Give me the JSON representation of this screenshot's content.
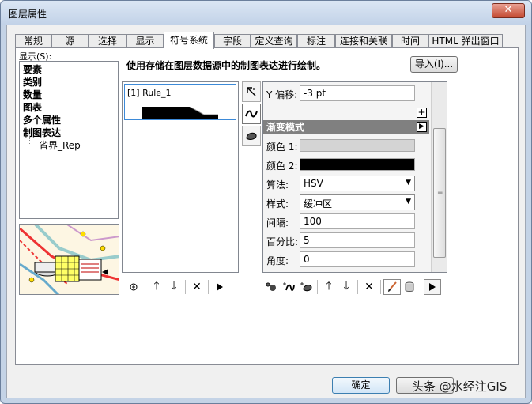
{
  "window": {
    "title": "图层属性",
    "close_label": "✕"
  },
  "tabs": [
    {
      "label": "常规",
      "active": false
    },
    {
      "label": "源",
      "active": false
    },
    {
      "label": "选择",
      "active": false
    },
    {
      "label": "显示",
      "active": false
    },
    {
      "label": "符号系统",
      "active": true
    },
    {
      "label": "字段",
      "active": false
    },
    {
      "label": "定义查询",
      "active": false
    },
    {
      "label": "标注",
      "active": false
    },
    {
      "label": "连接和关联",
      "active": false
    },
    {
      "label": "时间",
      "active": false
    },
    {
      "label": "HTML 弹出窗口",
      "active": false
    }
  ],
  "show_panel": {
    "label": "显示(S):",
    "items": [
      "要素",
      "类别",
      "数量",
      "图表",
      "多个属性",
      "制图表达"
    ],
    "child_item": "省界_Rep"
  },
  "description": "使用存储在图层数据源中的制图表达进行绘制。",
  "import_button": "导入(I)...",
  "rules": [
    {
      "label": "[1] Rule_1"
    }
  ],
  "properties": {
    "y_offset": {
      "label": "Y 偏移:",
      "value": "-3 pt"
    },
    "expand_symbol": "+",
    "gradient_section": "渐变模式",
    "color1": {
      "label": "颜色 1:",
      "color": "#d4d4d4"
    },
    "color2": {
      "label": "颜色 2:",
      "color": "#000000"
    },
    "algorithm": {
      "label": "算法:",
      "value": "HSV"
    },
    "style": {
      "label": "样式:",
      "value": "缓冲区"
    },
    "interval": {
      "label": "间隔:",
      "value": "100"
    },
    "percent": {
      "label": "百分比:",
      "value": "5"
    },
    "angle": {
      "label": "角度:",
      "value": "0"
    }
  },
  "buttons": {
    "ok": "确定"
  },
  "watermark": "头条 @水经注GIS",
  "colors": {
    "accent": "#3d8ad8",
    "section_header": "#808080"
  }
}
